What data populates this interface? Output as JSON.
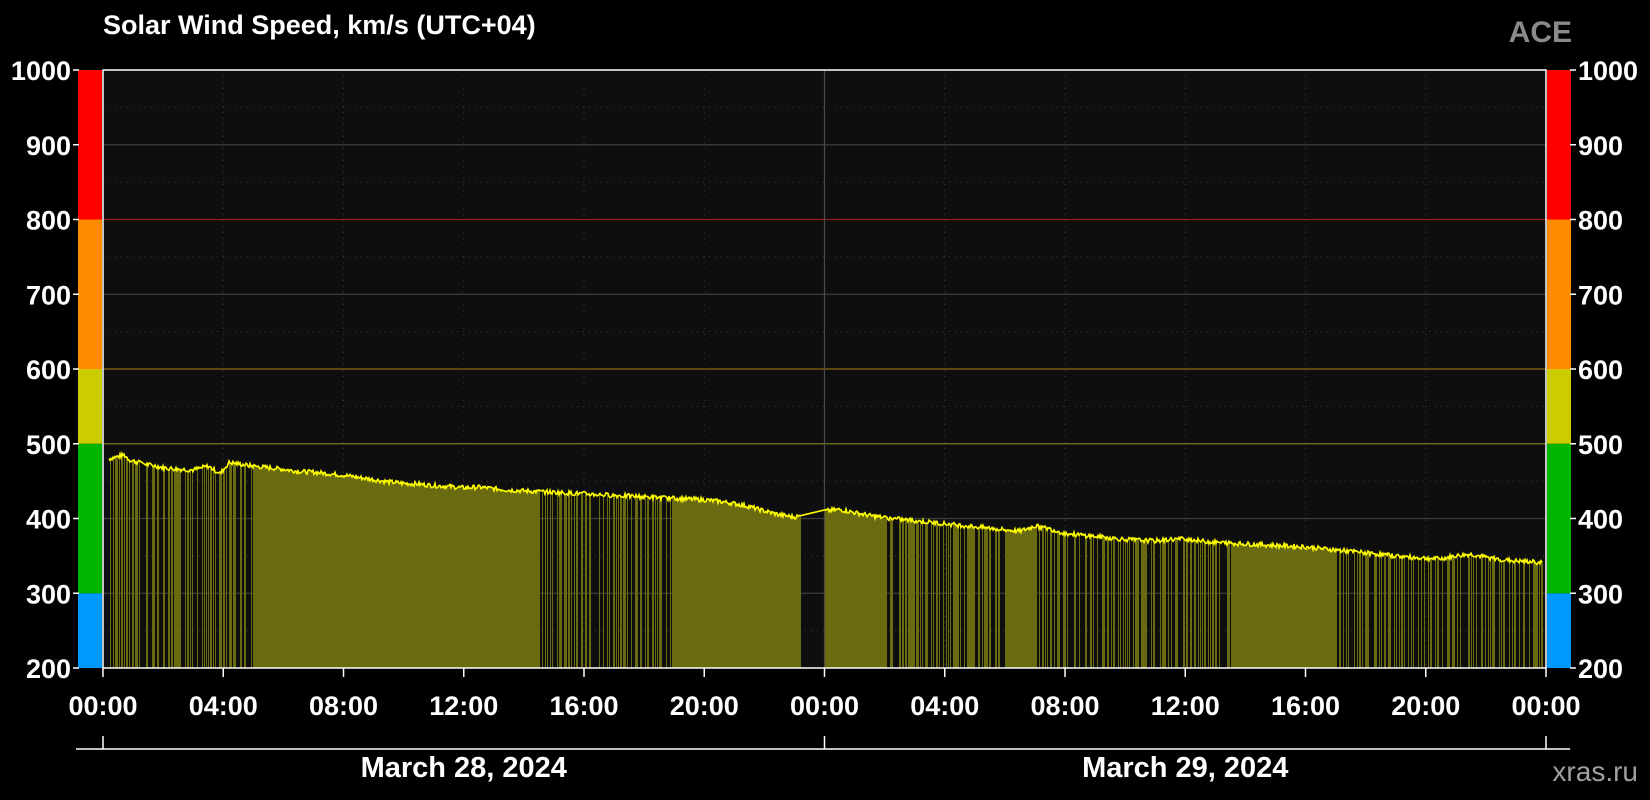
{
  "title": "Solar Wind Speed, km/s (UTC+04)",
  "source": "ACE",
  "credit": "xras.ru",
  "dates": [
    {
      "label": "March 28, 2024",
      "center_hour": 12
    },
    {
      "label": "March 29, 2024",
      "center_hour": 36
    }
  ],
  "chart_data": {
    "type": "bar",
    "title": "Solar Wind Speed, km/s (UTC+04)",
    "xlabel": "",
    "ylabel": "",
    "ylim": [
      200,
      1000
    ],
    "xlim_hours": [
      0,
      48
    ],
    "x_ticks": [
      "00:00",
      "04:00",
      "08:00",
      "12:00",
      "16:00",
      "20:00",
      "00:00",
      "04:00",
      "08:00",
      "12:00",
      "16:00",
      "20:00",
      "00:00"
    ],
    "y_ticks": [
      200,
      300,
      400,
      500,
      600,
      700,
      800,
      900,
      1000
    ],
    "grid": true,
    "color_bands": [
      {
        "from": 200,
        "to": 300,
        "color": "#0099ff"
      },
      {
        "from": 300,
        "to": 500,
        "color": "#00b400"
      },
      {
        "from": 500,
        "to": 600,
        "color": "#cccc00"
      },
      {
        "from": 600,
        "to": 800,
        "color": "#ff8c00"
      },
      {
        "from": 800,
        "to": 1000,
        "color": "#ff0000"
      }
    ],
    "threshold_lines": [
      {
        "value": 500,
        "color": "#7a7a10"
      },
      {
        "value": 600,
        "color": "#8a6a10"
      },
      {
        "value": 800,
        "color": "#8a2010"
      }
    ],
    "bar_color": "#6b6b10",
    "line_color": "#ffff00",
    "series": [
      {
        "x_hours": [
          0.2,
          0.7,
          0.9,
          1.2,
          1.5,
          1.8,
          2.0,
          2.5,
          3.0,
          3.5,
          3.9,
          4.2,
          5.0,
          5.5,
          6.0,
          6.5,
          7.0,
          7.5,
          8.0,
          8.5,
          9.0,
          9.5,
          10.0,
          10.5,
          11.0,
          11.5,
          12.0,
          12.5,
          13.0,
          13.5,
          14.0,
          14.5,
          15.0,
          15.5,
          16.0,
          16.5,
          17.0,
          17.5,
          18.0,
          18.5,
          19.0,
          19.5,
          20.0,
          20.5,
          21.0,
          21.5,
          22.0,
          22.5,
          23.0,
          23.5,
          24.0,
          24.5,
          25.0,
          25.5,
          26.0,
          26.5,
          27.0,
          27.5,
          28.0,
          28.5,
          29.0,
          29.5,
          30.0,
          30.5,
          31.0,
          31.5,
          32.0,
          32.5,
          33.0,
          33.5,
          34.0,
          34.5,
          35.0,
          35.5,
          36.0,
          36.5,
          37.0,
          37.5,
          38.0,
          38.5,
          39.0,
          39.5,
          40.0,
          40.5,
          41.0,
          41.5,
          42.0,
          42.5,
          43.0,
          43.5,
          44.0,
          44.5,
          45.0,
          45.5,
          46.0,
          46.5,
          47.0,
          47.5,
          47.9
        ],
        "values": [
          480,
          485,
          478,
          475,
          472,
          470,
          468,
          466,
          465,
          470,
          460,
          475,
          470,
          468,
          466,
          463,
          462,
          460,
          458,
          455,
          452,
          449,
          447,
          446,
          444,
          443,
          441,
          442,
          440,
          438,
          437,
          436,
          435,
          434,
          433,
          432,
          431,
          430,
          429,
          428,
          427,
          426,
          425,
          423,
          420,
          416,
          410,
          405,
          402,
          405,
          410,
          412,
          408,
          404,
          401,
          399,
          397,
          395,
          393,
          391,
          389,
          387,
          385,
          383,
          390,
          386,
          380,
          378,
          376,
          374,
          372,
          371,
          370,
          372,
          373,
          370,
          368,
          367,
          366,
          365,
          364,
          363,
          362,
          360,
          358,
          356,
          354,
          352,
          350,
          348,
          347,
          346,
          350,
          352,
          348,
          345,
          343,
          342,
          341,
          340,
          339,
          340,
          338
        ]
      }
    ]
  }
}
